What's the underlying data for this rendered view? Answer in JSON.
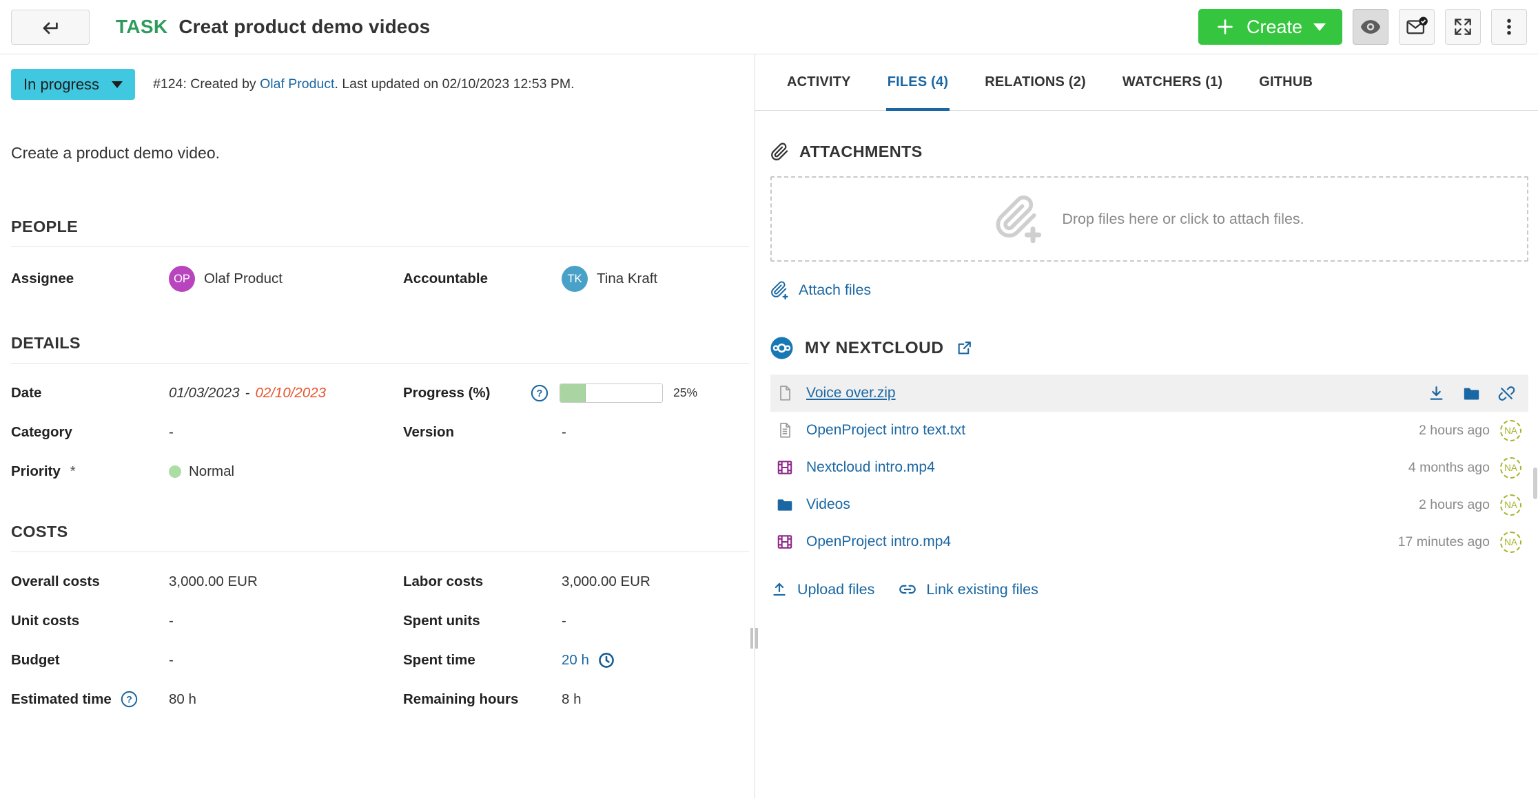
{
  "header": {
    "type_label": "TASK",
    "title": "Creat product demo videos",
    "create_label": "Create"
  },
  "status": {
    "label": "In progress",
    "meta_prefix": "#124: Created by ",
    "author": "Olaf Product",
    "meta_suffix": ". Last updated on 02/10/2023 12:53 PM."
  },
  "description": "Create a product demo video.",
  "people": {
    "title": "PEOPLE",
    "assignee": {
      "label": "Assignee",
      "initials": "OP",
      "name": "Olaf Product"
    },
    "accountable": {
      "label": "Accountable",
      "initials": "TK",
      "name": "Tina Kraft"
    }
  },
  "details": {
    "title": "DETAILS",
    "date": {
      "label": "Date",
      "start": "01/03/2023",
      "separator": "-",
      "due": "02/10/2023"
    },
    "progress": {
      "label": "Progress (%)",
      "value": 25,
      "display": "25%"
    },
    "category": {
      "label": "Category",
      "value": "-"
    },
    "version": {
      "label": "Version",
      "value": "-"
    },
    "priority": {
      "label": "Priority",
      "required_mark": "*",
      "value": "Normal"
    }
  },
  "costs": {
    "title": "COSTS",
    "overall": {
      "label": "Overall costs",
      "value": "3,000.00 EUR"
    },
    "labor": {
      "label": "Labor costs",
      "value": "3,000.00 EUR"
    },
    "unit": {
      "label": "Unit costs",
      "value": "-"
    },
    "spent_units": {
      "label": "Spent units",
      "value": "-"
    },
    "budget": {
      "label": "Budget",
      "value": "-"
    },
    "spent_time": {
      "label": "Spent time",
      "value": "20 h"
    },
    "estimated": {
      "label": "Estimated time",
      "value": "80 h"
    },
    "remaining": {
      "label": "Remaining hours",
      "value": "8 h"
    }
  },
  "tabs": [
    {
      "label": "ACTIVITY",
      "active": false
    },
    {
      "label": "FILES (4)",
      "active": true
    },
    {
      "label": "RELATIONS (2)",
      "active": false
    },
    {
      "label": "WATCHERS (1)",
      "active": false
    },
    {
      "label": "GITHUB",
      "active": false
    }
  ],
  "attachments": {
    "title": "ATTACHMENTS",
    "dropzone_text": "Drop files here or click to attach files.",
    "attach_label": "Attach files"
  },
  "nextcloud": {
    "title": "MY NEXTCLOUD",
    "files": [
      {
        "name": "Voice over.zip",
        "type": "archive",
        "time": "",
        "badge": ""
      },
      {
        "name": "OpenProject intro text.txt",
        "type": "text",
        "time": "2 hours ago",
        "badge": "NA"
      },
      {
        "name": "Nextcloud intro.mp4",
        "type": "video",
        "time": "4 months ago",
        "badge": "NA"
      },
      {
        "name": "Videos",
        "type": "folder",
        "time": "2 hours ago",
        "badge": "NA"
      },
      {
        "name": "OpenProject intro.mp4",
        "type": "video",
        "time": "17 minutes ago",
        "badge": "NA"
      }
    ],
    "upload_label": "Upload files",
    "link_label": "Link existing files"
  },
  "icons": {
    "back": "arrow-left-with-hook",
    "create": "plus",
    "watch": "eye",
    "notifications": "envelope-check",
    "fullscreen": "expand-arrows",
    "more": "kebab-dots",
    "attachments": "paperclip",
    "dropzone": "paperclip-plus",
    "help": "question-circle",
    "spent_time": "clock",
    "storage": "nextcloud-logo",
    "open_storage": "external-link",
    "download": "download-arrow",
    "locate": "folder",
    "unlink": "link-slash",
    "upload": "upload-arrow",
    "link_existing": "link"
  },
  "colors": {
    "create_green": "#35c53f",
    "type_green": "#2d9c5a",
    "link_blue": "#1a67a3",
    "status_cyan": "#40c8e0",
    "overdue_orange": "#e8542d",
    "badge_olive": "#a6b42c",
    "video_magenta": "#8c2787",
    "avatar_purple": "#b844be",
    "avatar_blue": "#4aa1c8",
    "progress_green": "#a9d5a2"
  }
}
